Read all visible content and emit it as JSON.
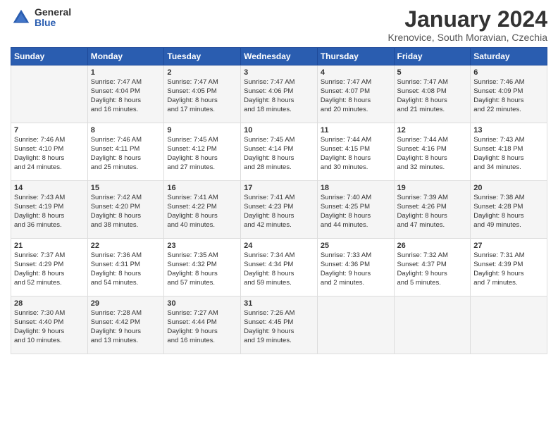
{
  "header": {
    "logo_general": "General",
    "logo_blue": "Blue",
    "title": "January 2024",
    "subtitle": "Krenovice, South Moravian, Czechia"
  },
  "days_of_week": [
    "Sunday",
    "Monday",
    "Tuesday",
    "Wednesday",
    "Thursday",
    "Friday",
    "Saturday"
  ],
  "weeks": [
    {
      "cells": [
        {
          "day": "",
          "content": ""
        },
        {
          "day": "1",
          "content": "Sunrise: 7:47 AM\nSunset: 4:04 PM\nDaylight: 8 hours\nand 16 minutes."
        },
        {
          "day": "2",
          "content": "Sunrise: 7:47 AM\nSunset: 4:05 PM\nDaylight: 8 hours\nand 17 minutes."
        },
        {
          "day": "3",
          "content": "Sunrise: 7:47 AM\nSunset: 4:06 PM\nDaylight: 8 hours\nand 18 minutes."
        },
        {
          "day": "4",
          "content": "Sunrise: 7:47 AM\nSunset: 4:07 PM\nDaylight: 8 hours\nand 20 minutes."
        },
        {
          "day": "5",
          "content": "Sunrise: 7:47 AM\nSunset: 4:08 PM\nDaylight: 8 hours\nand 21 minutes."
        },
        {
          "day": "6",
          "content": "Sunrise: 7:46 AM\nSunset: 4:09 PM\nDaylight: 8 hours\nand 22 minutes."
        }
      ]
    },
    {
      "cells": [
        {
          "day": "7",
          "content": "Sunrise: 7:46 AM\nSunset: 4:10 PM\nDaylight: 8 hours\nand 24 minutes."
        },
        {
          "day": "8",
          "content": "Sunrise: 7:46 AM\nSunset: 4:11 PM\nDaylight: 8 hours\nand 25 minutes."
        },
        {
          "day": "9",
          "content": "Sunrise: 7:45 AM\nSunset: 4:12 PM\nDaylight: 8 hours\nand 27 minutes."
        },
        {
          "day": "10",
          "content": "Sunrise: 7:45 AM\nSunset: 4:14 PM\nDaylight: 8 hours\nand 28 minutes."
        },
        {
          "day": "11",
          "content": "Sunrise: 7:44 AM\nSunset: 4:15 PM\nDaylight: 8 hours\nand 30 minutes."
        },
        {
          "day": "12",
          "content": "Sunrise: 7:44 AM\nSunset: 4:16 PM\nDaylight: 8 hours\nand 32 minutes."
        },
        {
          "day": "13",
          "content": "Sunrise: 7:43 AM\nSunset: 4:18 PM\nDaylight: 8 hours\nand 34 minutes."
        }
      ]
    },
    {
      "cells": [
        {
          "day": "14",
          "content": "Sunrise: 7:43 AM\nSunset: 4:19 PM\nDaylight: 8 hours\nand 36 minutes."
        },
        {
          "day": "15",
          "content": "Sunrise: 7:42 AM\nSunset: 4:20 PM\nDaylight: 8 hours\nand 38 minutes."
        },
        {
          "day": "16",
          "content": "Sunrise: 7:41 AM\nSunset: 4:22 PM\nDaylight: 8 hours\nand 40 minutes."
        },
        {
          "day": "17",
          "content": "Sunrise: 7:41 AM\nSunset: 4:23 PM\nDaylight: 8 hours\nand 42 minutes."
        },
        {
          "day": "18",
          "content": "Sunrise: 7:40 AM\nSunset: 4:25 PM\nDaylight: 8 hours\nand 44 minutes."
        },
        {
          "day": "19",
          "content": "Sunrise: 7:39 AM\nSunset: 4:26 PM\nDaylight: 8 hours\nand 47 minutes."
        },
        {
          "day": "20",
          "content": "Sunrise: 7:38 AM\nSunset: 4:28 PM\nDaylight: 8 hours\nand 49 minutes."
        }
      ]
    },
    {
      "cells": [
        {
          "day": "21",
          "content": "Sunrise: 7:37 AM\nSunset: 4:29 PM\nDaylight: 8 hours\nand 52 minutes."
        },
        {
          "day": "22",
          "content": "Sunrise: 7:36 AM\nSunset: 4:31 PM\nDaylight: 8 hours\nand 54 minutes."
        },
        {
          "day": "23",
          "content": "Sunrise: 7:35 AM\nSunset: 4:32 PM\nDaylight: 8 hours\nand 57 minutes."
        },
        {
          "day": "24",
          "content": "Sunrise: 7:34 AM\nSunset: 4:34 PM\nDaylight: 8 hours\nand 59 minutes."
        },
        {
          "day": "25",
          "content": "Sunrise: 7:33 AM\nSunset: 4:36 PM\nDaylight: 9 hours\nand 2 minutes."
        },
        {
          "day": "26",
          "content": "Sunrise: 7:32 AM\nSunset: 4:37 PM\nDaylight: 9 hours\nand 5 minutes."
        },
        {
          "day": "27",
          "content": "Sunrise: 7:31 AM\nSunset: 4:39 PM\nDaylight: 9 hours\nand 7 minutes."
        }
      ]
    },
    {
      "cells": [
        {
          "day": "28",
          "content": "Sunrise: 7:30 AM\nSunset: 4:40 PM\nDaylight: 9 hours\nand 10 minutes."
        },
        {
          "day": "29",
          "content": "Sunrise: 7:28 AM\nSunset: 4:42 PM\nDaylight: 9 hours\nand 13 minutes."
        },
        {
          "day": "30",
          "content": "Sunrise: 7:27 AM\nSunset: 4:44 PM\nDaylight: 9 hours\nand 16 minutes."
        },
        {
          "day": "31",
          "content": "Sunrise: 7:26 AM\nSunset: 4:45 PM\nDaylight: 9 hours\nand 19 minutes."
        },
        {
          "day": "",
          "content": ""
        },
        {
          "day": "",
          "content": ""
        },
        {
          "day": "",
          "content": ""
        }
      ]
    }
  ]
}
